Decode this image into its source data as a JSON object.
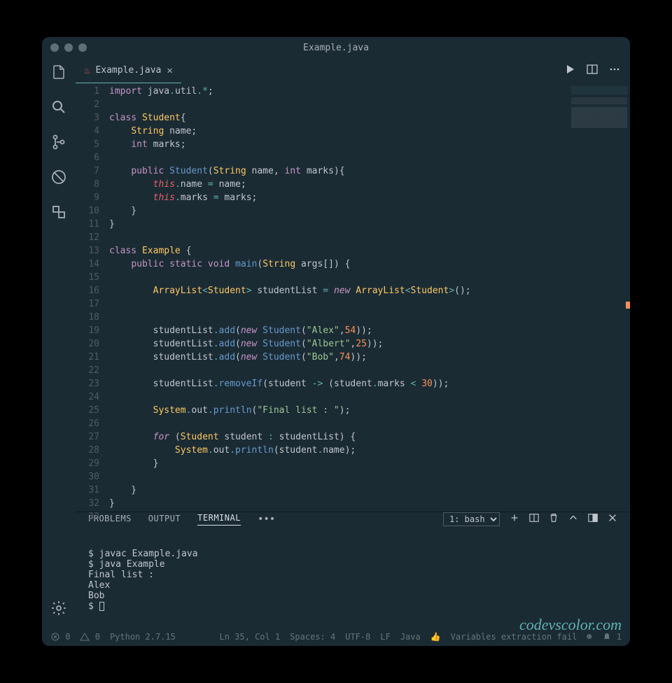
{
  "window": {
    "title": "Example.java"
  },
  "tab": {
    "filename": "Example.java",
    "icon": "java-icon"
  },
  "editor": {
    "line_count": 33,
    "tokens": [
      [
        [
          "kw",
          "import"
        ],
        [
          "pun",
          " "
        ],
        [
          "id",
          "java"
        ],
        [
          "op",
          "."
        ],
        [
          "id",
          "util"
        ],
        [
          "op",
          ".*"
        ],
        [
          "pun",
          ";"
        ]
      ],
      [],
      [
        [
          "kw",
          "class"
        ],
        [
          "pun",
          " "
        ],
        [
          "type",
          "Student"
        ],
        [
          "pun",
          "{"
        ]
      ],
      [
        [
          "pun",
          "    "
        ],
        [
          "type",
          "String"
        ],
        [
          "pun",
          " "
        ],
        [
          "id",
          "name"
        ],
        [
          "pun",
          ";"
        ]
      ],
      [
        [
          "pun",
          "    "
        ],
        [
          "kw",
          "int"
        ],
        [
          "pun",
          " "
        ],
        [
          "id",
          "marks"
        ],
        [
          "pun",
          ";"
        ]
      ],
      [],
      [
        [
          "pun",
          "    "
        ],
        [
          "kw",
          "public"
        ],
        [
          "pun",
          " "
        ],
        [
          "fn",
          "Student"
        ],
        [
          "pun",
          "("
        ],
        [
          "type",
          "String"
        ],
        [
          "pun",
          " "
        ],
        [
          "id",
          "name"
        ],
        [
          "pun",
          ", "
        ],
        [
          "kw",
          "int"
        ],
        [
          "pun",
          " "
        ],
        [
          "id",
          "marks"
        ],
        [
          "pun",
          "){"
        ]
      ],
      [
        [
          "pun",
          "        "
        ],
        [
          "this",
          "this"
        ],
        [
          "op",
          "."
        ],
        [
          "id",
          "name"
        ],
        [
          "pun",
          " "
        ],
        [
          "op",
          "="
        ],
        [
          "pun",
          " "
        ],
        [
          "id",
          "name"
        ],
        [
          "pun",
          ";"
        ]
      ],
      [
        [
          "pun",
          "        "
        ],
        [
          "this",
          "this"
        ],
        [
          "op",
          "."
        ],
        [
          "id",
          "marks"
        ],
        [
          "pun",
          " "
        ],
        [
          "op",
          "="
        ],
        [
          "pun",
          " "
        ],
        [
          "id",
          "marks"
        ],
        [
          "pun",
          ";"
        ]
      ],
      [
        [
          "pun",
          "    }"
        ]
      ],
      [
        [
          "pun",
          "}"
        ]
      ],
      [],
      [
        [
          "kw",
          "class"
        ],
        [
          "pun",
          " "
        ],
        [
          "type",
          "Example"
        ],
        [
          "pun",
          " {"
        ]
      ],
      [
        [
          "pun",
          "    "
        ],
        [
          "kw",
          "public"
        ],
        [
          "pun",
          " "
        ],
        [
          "kw",
          "static"
        ],
        [
          "pun",
          " "
        ],
        [
          "kw",
          "void"
        ],
        [
          "pun",
          " "
        ],
        [
          "fn",
          "main"
        ],
        [
          "pun",
          "("
        ],
        [
          "type",
          "String"
        ],
        [
          "pun",
          " "
        ],
        [
          "id",
          "args"
        ],
        [
          "pun",
          "[]"
        ],
        [
          "pun",
          ") {"
        ]
      ],
      [],
      [
        [
          "pun",
          "        "
        ],
        [
          "type",
          "ArrayList"
        ],
        [
          "op",
          "<"
        ],
        [
          "type",
          "Student"
        ],
        [
          "op",
          ">"
        ],
        [
          "pun",
          " "
        ],
        [
          "id",
          "studentList"
        ],
        [
          "pun",
          " "
        ],
        [
          "op",
          "="
        ],
        [
          "pun",
          " "
        ],
        [
          "kw2",
          "new"
        ],
        [
          "pun",
          " "
        ],
        [
          "type",
          "ArrayList"
        ],
        [
          "op",
          "<"
        ],
        [
          "type",
          "Student"
        ],
        [
          "op",
          ">"
        ],
        [
          "pun",
          "();"
        ]
      ],
      [],
      [],
      [
        [
          "pun",
          "        "
        ],
        [
          "id",
          "studentList"
        ],
        [
          "op",
          "."
        ],
        [
          "fn",
          "add"
        ],
        [
          "pun",
          "("
        ],
        [
          "kw2",
          "new"
        ],
        [
          "pun",
          " "
        ],
        [
          "fn",
          "Student"
        ],
        [
          "pun",
          "("
        ],
        [
          "str",
          "\"Alex\""
        ],
        [
          "pun",
          ","
        ],
        [
          "num",
          "54"
        ],
        [
          "pun",
          "));"
        ]
      ],
      [
        [
          "pun",
          "        "
        ],
        [
          "id",
          "studentList"
        ],
        [
          "op",
          "."
        ],
        [
          "fn",
          "add"
        ],
        [
          "pun",
          "("
        ],
        [
          "kw2",
          "new"
        ],
        [
          "pun",
          " "
        ],
        [
          "fn",
          "Student"
        ],
        [
          "pun",
          "("
        ],
        [
          "str",
          "\"Albert\""
        ],
        [
          "pun",
          ","
        ],
        [
          "num",
          "25"
        ],
        [
          "pun",
          "));"
        ]
      ],
      [
        [
          "pun",
          "        "
        ],
        [
          "id",
          "studentList"
        ],
        [
          "op",
          "."
        ],
        [
          "fn",
          "add"
        ],
        [
          "pun",
          "("
        ],
        [
          "kw2",
          "new"
        ],
        [
          "pun",
          " "
        ],
        [
          "fn",
          "Student"
        ],
        [
          "pun",
          "("
        ],
        [
          "str",
          "\"Bob\""
        ],
        [
          "pun",
          ","
        ],
        [
          "num",
          "74"
        ],
        [
          "pun",
          "));"
        ]
      ],
      [],
      [
        [
          "pun",
          "        "
        ],
        [
          "id",
          "studentList"
        ],
        [
          "op",
          "."
        ],
        [
          "fn",
          "removeIf"
        ],
        [
          "pun",
          "("
        ],
        [
          "id",
          "student"
        ],
        [
          "pun",
          " "
        ],
        [
          "op",
          "->"
        ],
        [
          "pun",
          " ("
        ],
        [
          "id",
          "student"
        ],
        [
          "op",
          "."
        ],
        [
          "id",
          "marks"
        ],
        [
          "pun",
          " "
        ],
        [
          "op",
          "<"
        ],
        [
          "pun",
          " "
        ],
        [
          "num",
          "30"
        ],
        [
          "pun",
          "));"
        ]
      ],
      [],
      [
        [
          "pun",
          "        "
        ],
        [
          "type",
          "System"
        ],
        [
          "op",
          "."
        ],
        [
          "id",
          "out"
        ],
        [
          "op",
          "."
        ],
        [
          "fn",
          "println"
        ],
        [
          "pun",
          "("
        ],
        [
          "str",
          "\"Final list : \""
        ],
        [
          "pun",
          ");"
        ]
      ],
      [],
      [
        [
          "pun",
          "        "
        ],
        [
          "kw2",
          "for"
        ],
        [
          "pun",
          " ("
        ],
        [
          "type",
          "Student"
        ],
        [
          "pun",
          " "
        ],
        [
          "id",
          "student"
        ],
        [
          "pun",
          " "
        ],
        [
          "op",
          ":"
        ],
        [
          "pun",
          " "
        ],
        [
          "id",
          "studentList"
        ],
        [
          "pun",
          ") {"
        ]
      ],
      [
        [
          "pun",
          "            "
        ],
        [
          "type",
          "System"
        ],
        [
          "op",
          "."
        ],
        [
          "id",
          "out"
        ],
        [
          "op",
          "."
        ],
        [
          "fn",
          "println"
        ],
        [
          "pun",
          "("
        ],
        [
          "id",
          "student"
        ],
        [
          "op",
          "."
        ],
        [
          "id",
          "name"
        ],
        [
          "pun",
          ");"
        ]
      ],
      [
        [
          "pun",
          "        }"
        ]
      ],
      [],
      [
        [
          "pun",
          "    }"
        ]
      ],
      [
        [
          "pun",
          "}"
        ]
      ],
      []
    ]
  },
  "panel": {
    "tabs": [
      "PROBLEMS",
      "OUTPUT",
      "TERMINAL"
    ],
    "active": 2,
    "shell_select": "1: bash",
    "terminal_lines": [
      "$ javac Example.java",
      "$ java Example",
      "Final list :",
      "Alex",
      "Bob",
      "$ "
    ],
    "watermark": "codevscolor.com"
  },
  "status": {
    "errors": "0",
    "warnings": "0",
    "interpreter": "Python 2.7.15",
    "cursor": "Ln 35, Col 1",
    "spaces": "Spaces: 4",
    "encoding": "UTF-8",
    "eol": "LF",
    "language": "Java",
    "msg": "Variables extraction fail",
    "bell": "1"
  }
}
